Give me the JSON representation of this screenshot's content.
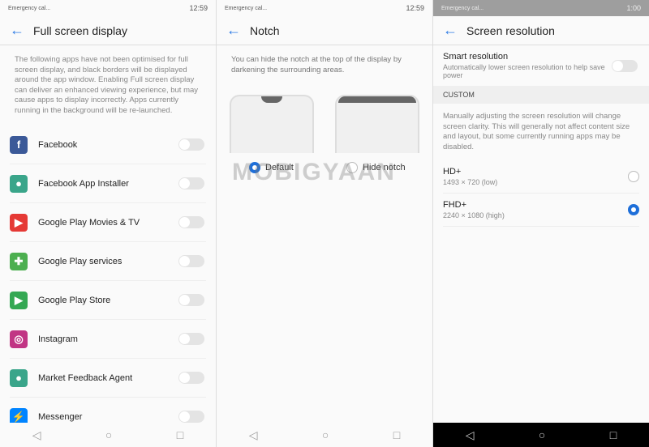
{
  "status": {
    "left": "Emergency cal...",
    "time1": "12:59",
    "time2": "12:59",
    "time3": "1:00"
  },
  "p1": {
    "title": "Full screen display",
    "desc": "The following apps have not been optimised for full screen display, and black borders will be displayed around the app window. Enabling Full screen display can deliver an enhanced viewing experience, but may cause apps to display incorrectly. Apps currently running in the background will be re-launched.",
    "apps": [
      {
        "label": "Facebook",
        "glyph": "f",
        "color": "#3b5998"
      },
      {
        "label": "Facebook App Installer",
        "glyph": "●",
        "color": "#3aa58a"
      },
      {
        "label": "Google Play Movies & TV",
        "glyph": "▶",
        "color": "#e53935"
      },
      {
        "label": "Google Play services",
        "glyph": "✚",
        "color": "#4caf50"
      },
      {
        "label": "Google Play Store",
        "glyph": "▶",
        "color": "#34a853"
      },
      {
        "label": "Instagram",
        "glyph": "◎",
        "color": "#c13584"
      },
      {
        "label": "Market Feedback Agent",
        "glyph": "●",
        "color": "#3aa58a"
      },
      {
        "label": "Messenger",
        "glyph": "⚡",
        "color": "#0084ff"
      }
    ]
  },
  "p2": {
    "title": "Notch",
    "desc": "You can hide the notch at the top of the display by darkening the surrounding areas.",
    "opt_default": "Default",
    "opt_hide": "Hide notch",
    "selected": "Default"
  },
  "p3": {
    "title": "Screen resolution",
    "smart_title": "Smart resolution",
    "smart_desc": "Automatically lower screen resolution to help save power",
    "smart_on": false,
    "section": "CUSTOM",
    "desc": "Manually adjusting the screen resolution will change screen clarity. This will generally not affect content size and layout, but some currently running apps may be disabled.",
    "options": [
      {
        "title": "HD+",
        "sub": "1493 × 720 (low)",
        "selected": false
      },
      {
        "title": "FHD+",
        "sub": "2240 × 1080 (high)",
        "selected": true
      }
    ]
  },
  "watermark": "MOBIGYAAN",
  "accent": "#1e6fd9"
}
